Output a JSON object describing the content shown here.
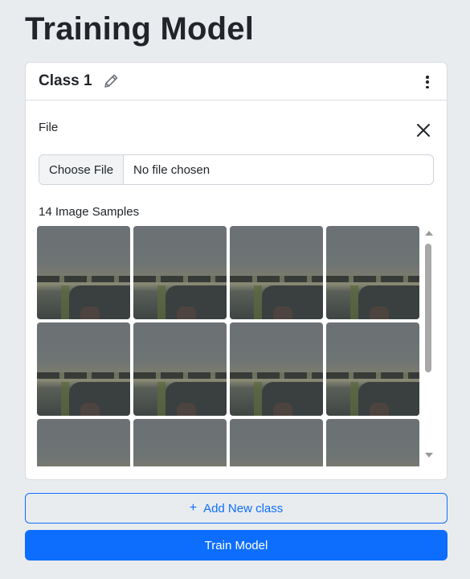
{
  "page": {
    "title": "Training Model"
  },
  "class_card": {
    "name": "Class 1",
    "edit_icon": "pencil-icon",
    "menu_icon": "kebab-menu-icon",
    "file_label": "File",
    "close_icon": "close-icon",
    "file_input": {
      "button_label": "Choose File",
      "status": "No file chosen"
    },
    "samples_label": "14 Image Samples",
    "sample_count": 14,
    "visible_thumbnails": 12
  },
  "actions": {
    "add_class_icon": "plus-icon",
    "add_class_label": "Add New class",
    "train_label": "Train Model"
  },
  "colors": {
    "primary": "#0d6efd",
    "background": "#e9ecef",
    "card": "#ffffff"
  }
}
